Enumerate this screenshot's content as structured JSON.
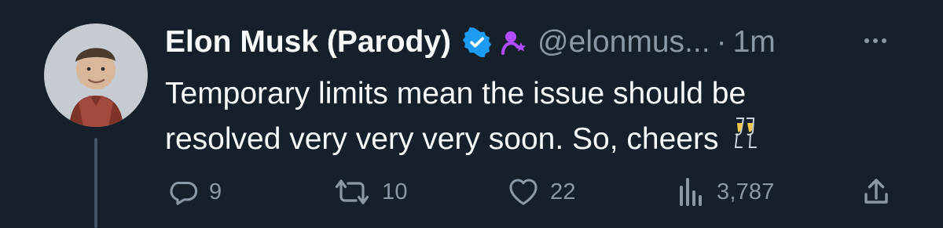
{
  "tweet": {
    "author": {
      "display_name": "Elon Musk (Parody)",
      "handle": "@elonmus...",
      "time_separator": "·",
      "time_ago": "1m",
      "badges": [
        "verified-badge-icon",
        "parody-account-icon"
      ]
    },
    "text": "Temporary limits mean the issue should be\nresolved very very very soon. So, cheers",
    "emoji": "champagne-glasses-icon",
    "actions": {
      "reply_count": "9",
      "retweet_count": "10",
      "like_count": "22",
      "views_count": "3,787"
    },
    "colors": {
      "background": "#15202b",
      "primary_text": "#f7f9f9",
      "secondary_text": "#8b98a5",
      "verified": "#1d9bf0",
      "parody_badge": "#b14cff"
    }
  }
}
